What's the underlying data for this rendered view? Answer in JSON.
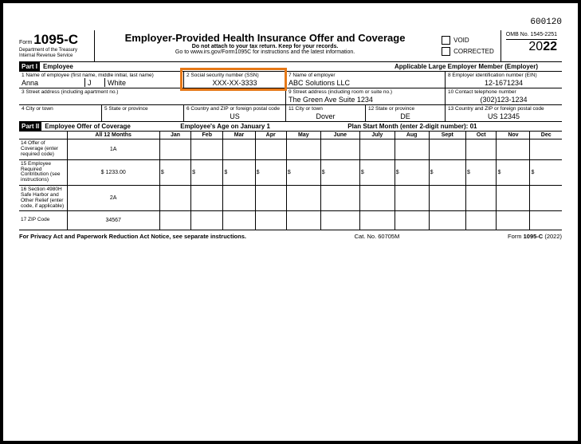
{
  "topCode": "600120",
  "form": {
    "prefix": "Form",
    "number": "1095-C",
    "dept": "Department of the Treasury",
    "irs": "Internal Revenue Service"
  },
  "hdr": {
    "title": "Employer-Provided Health Insurance Offer and Coverage",
    "sub1": "Do not attach to your tax return. Keep for your records.",
    "sub2": "Go to www.irs.gov/Form1095C for instructions and the latest information."
  },
  "checks": {
    "void": "VOID",
    "corrected": "CORRECTED"
  },
  "omb": "OMB No. 1545-2251",
  "yearPrefix": "20",
  "yearSuffix": "22",
  "part1": {
    "bar": "Part I",
    "emp": "Employee",
    "aler": "Applicable Large Employer Member (Employer)"
  },
  "f1": {
    "lbl": "1  Name of employee (first name, middle initial, last name)",
    "first": "Anna",
    "mi": "J",
    "last": "White"
  },
  "f2": {
    "lbl": "2  Social security number (SSN)",
    "val": "XXX-XX-3333"
  },
  "f7": {
    "lbl": "7  Name of employer",
    "val": "ABC Solutions LLC"
  },
  "f8": {
    "lbl": "8  Employer identification number (EIN)",
    "val": "12-1671234"
  },
  "f3": {
    "lbl": "3  Street address (including apartment no.)",
    "val": ""
  },
  "f9": {
    "lbl": "9  Street address (including room or suite no.)",
    "val": "The Green Ave Suite 1234"
  },
  "f10": {
    "lbl": "10 Contact telephone number",
    "val": "(302)123-1234"
  },
  "f4": {
    "lbl": "4  City or town",
    "val": ""
  },
  "f5": {
    "lbl": "5  State or province",
    "val": ""
  },
  "f6": {
    "lbl": "6 Country and ZIP or foreign postal code",
    "val": "US"
  },
  "f11": {
    "lbl": "11 City or town",
    "val": "Dover"
  },
  "f12": {
    "lbl": "12  State or province",
    "val": "DE"
  },
  "f13": {
    "lbl": "13 Country and ZIP or foreign postal code",
    "val": "US 12345"
  },
  "part2": {
    "bar": "Part II",
    "t1": "Employee Offer of Coverage",
    "t2": "Employee's Age on January 1",
    "t3": "Plan Start Month (enter 2-digit number): 01"
  },
  "cols": {
    "all": "All 12 Months",
    "m": [
      "Jan",
      "Feb",
      "Mar",
      "Apr",
      "May",
      "June",
      "July",
      "Aug",
      "Sept",
      "Oct",
      "Nov",
      "Dec"
    ]
  },
  "r14": {
    "lbl": "14 Offer of Coverage (enter required code)",
    "all": "1A"
  },
  "r15": {
    "lbl": "15 Employee Required Contribution (see instructions)",
    "all": "1233.00"
  },
  "r16": {
    "lbl": "16 Section 4980H Safe Harbor and Other Relief (enter code, if applicable)",
    "all": "2A"
  },
  "r17": {
    "lbl": "17 ZIP Code",
    "all": "34567"
  },
  "ftr": {
    "priv": "For Privacy Act and Paperwork Reduction Act Notice, see separate instructions.",
    "cat": "Cat. No. 60705M",
    "form": "Form 1095-C (2022)"
  }
}
